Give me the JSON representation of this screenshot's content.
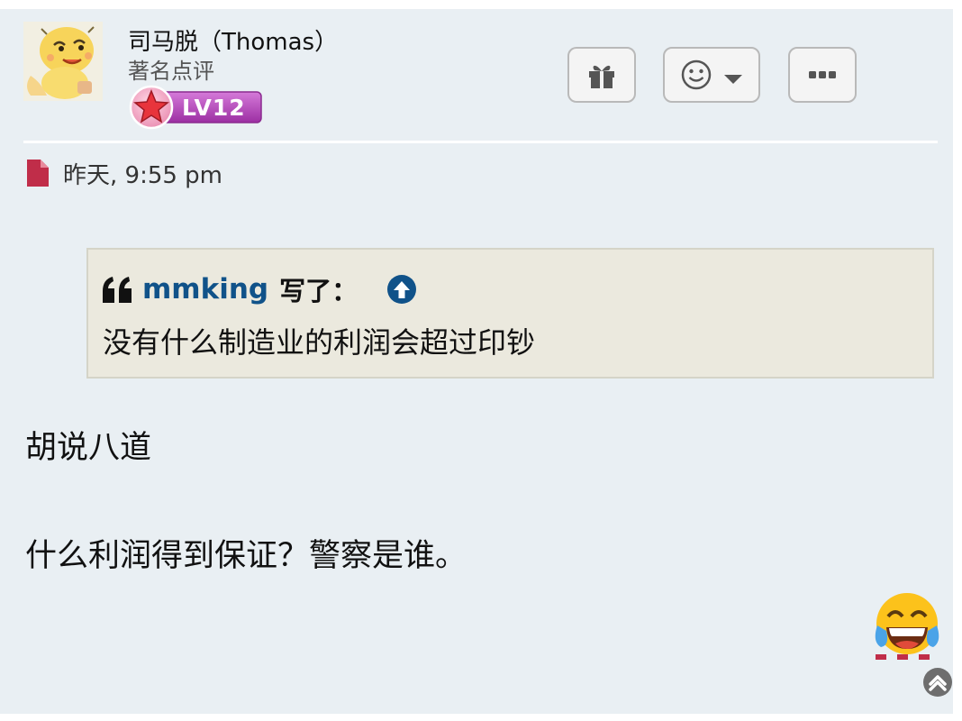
{
  "post": {
    "author": {
      "username": "司马脱（Thomas）",
      "rank_title": "著名点评",
      "level_badge": "LV12"
    },
    "actions": {
      "gift_icon": "gift-icon",
      "reaction_icon": "smiley-icon",
      "dropdown_icon": "caret-down-icon",
      "more_icon": "ellipsis-icon"
    },
    "meta": {
      "post_icon": "file-icon",
      "timestamp": "昨天, 9:55 pm"
    },
    "quote": {
      "author": "mmking",
      "wrote_label": "写了：",
      "text": "没有什么制造业的利润会超过印钞"
    },
    "body": {
      "lines": [
        "胡说八道",
        "什么利润得到保证？警察是谁。"
      ]
    },
    "reaction": {
      "emoji": "😂"
    },
    "colors": {
      "background": "#e9eff3",
      "quote_background": "#ebe9de",
      "link": "#105289",
      "file_icon": "#c02d49",
      "badge": "#b43fb8"
    }
  }
}
